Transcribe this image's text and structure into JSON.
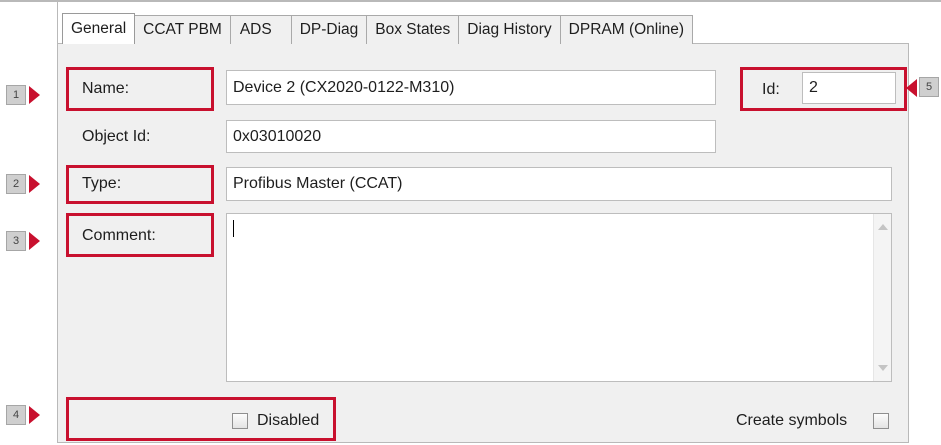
{
  "tabs": [
    "General",
    "CCAT PBM",
    "ADS",
    "DP-Diag",
    "Box States",
    "Diag History",
    "DPRAM (Online)"
  ],
  "active_tab": "General",
  "form": {
    "name_label": "Name:",
    "name_value": "Device 2 (CX2020-0122-M310)",
    "id_label": "Id:",
    "id_value": "2",
    "object_id_label": "Object Id:",
    "object_id_value": "0x03010020",
    "type_label": "Type:",
    "type_value": "Profibus Master (CCAT)",
    "comment_label": "Comment:",
    "comment_value": "",
    "disabled_label": "Disabled",
    "disabled_checked": false,
    "create_symbols_label": "Create symbols",
    "create_symbols_checked": false
  },
  "callouts": [
    "1",
    "2",
    "3",
    "4",
    "5"
  ],
  "colors": {
    "callout_red": "#c8102e",
    "panel_bg": "#f0f0f0"
  }
}
